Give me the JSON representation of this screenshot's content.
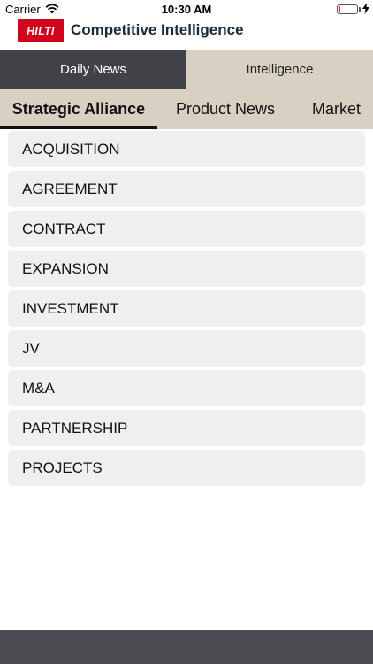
{
  "status": {
    "carrier": "Carrier",
    "time": "10:30 AM",
    "battery_level": 0.1,
    "battery_color": "#ee1111"
  },
  "header": {
    "logo_text": "HILTI",
    "title": "Competitive Intelligence",
    "brand_color": "#d2051e"
  },
  "top_tabs": [
    {
      "label": "Daily News",
      "active": true
    },
    {
      "label": "Intelligence",
      "active": false
    }
  ],
  "sub_tabs": [
    {
      "label": "Strategic Alliance",
      "active": true
    },
    {
      "label": "Product News",
      "active": false
    },
    {
      "label": "Market",
      "active": false
    }
  ],
  "list": {
    "items": [
      "ACQUISITION",
      "AGREEMENT",
      "CONTRACT",
      "EXPANSION",
      "INVESTMENT",
      "JV",
      "M&A",
      "PARTNERSHIP",
      "PROJECTS"
    ]
  },
  "colors": {
    "tab_active_bg": "#414247",
    "tab_inactive_bg": "#d8d0c2",
    "list_item_bg": "#efefef",
    "bottom_bar": "#4b4c51"
  }
}
